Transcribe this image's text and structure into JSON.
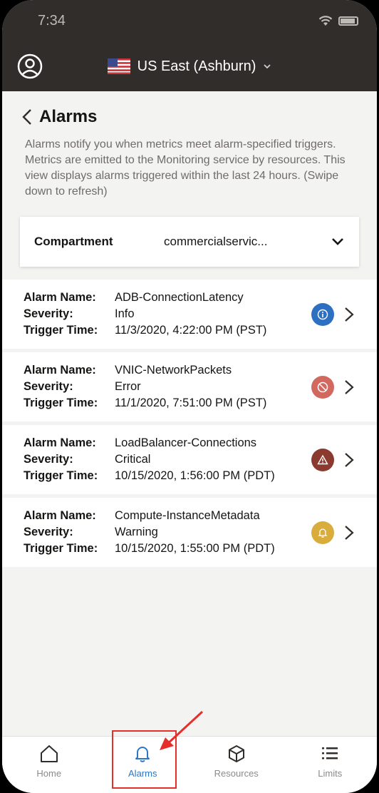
{
  "status": {
    "time": "7:34"
  },
  "header": {
    "region": "US East (Ashburn)"
  },
  "page": {
    "title": "Alarms",
    "description": "Alarms notify you when metrics meet alarm-specified triggers. Metrics are emitted to the Monitoring service by resources. This view displays alarms triggered within the last 24 hours. (Swipe down to refresh)"
  },
  "compartment": {
    "label": "Compartment",
    "value": "commercialservic..."
  },
  "field_labels": {
    "name": "Alarm Name:",
    "severity": "Severity:",
    "trigger": "Trigger Time:"
  },
  "alarms": [
    {
      "name": "ADB-ConnectionLatency",
      "severity": "Info",
      "trigger_time": "11/3/2020, 4:22:00 PM (PST)",
      "icon": "info-icon",
      "color": "#2d6fc0"
    },
    {
      "name": "VNIC-NetworkPackets",
      "severity": "Error",
      "trigger_time": "11/1/2020, 7:51:00 PM (PST)",
      "icon": "error-icon",
      "color": "#d2695f"
    },
    {
      "name": "LoadBalancer-Connections",
      "severity": "Critical",
      "trigger_time": "10/15/2020, 1:56:00 PM (PDT)",
      "icon": "critical-icon",
      "color": "#8a3a2f"
    },
    {
      "name": "Compute-InstanceMetadata",
      "severity": "Warning",
      "trigger_time": "10/15/2020, 1:55:00 PM (PDT)",
      "icon": "warning-icon",
      "color": "#d9ad3c"
    }
  ],
  "tabs": [
    {
      "label": "Home",
      "icon": "home-icon"
    },
    {
      "label": "Alarms",
      "icon": "bell-icon",
      "active": true
    },
    {
      "label": "Resources",
      "icon": "cube-icon"
    },
    {
      "label": "Limits",
      "icon": "list-icon"
    }
  ],
  "colors": {
    "header": "#312d2a",
    "accent": "#2d76c1",
    "highlight": "#e52f2a"
  }
}
